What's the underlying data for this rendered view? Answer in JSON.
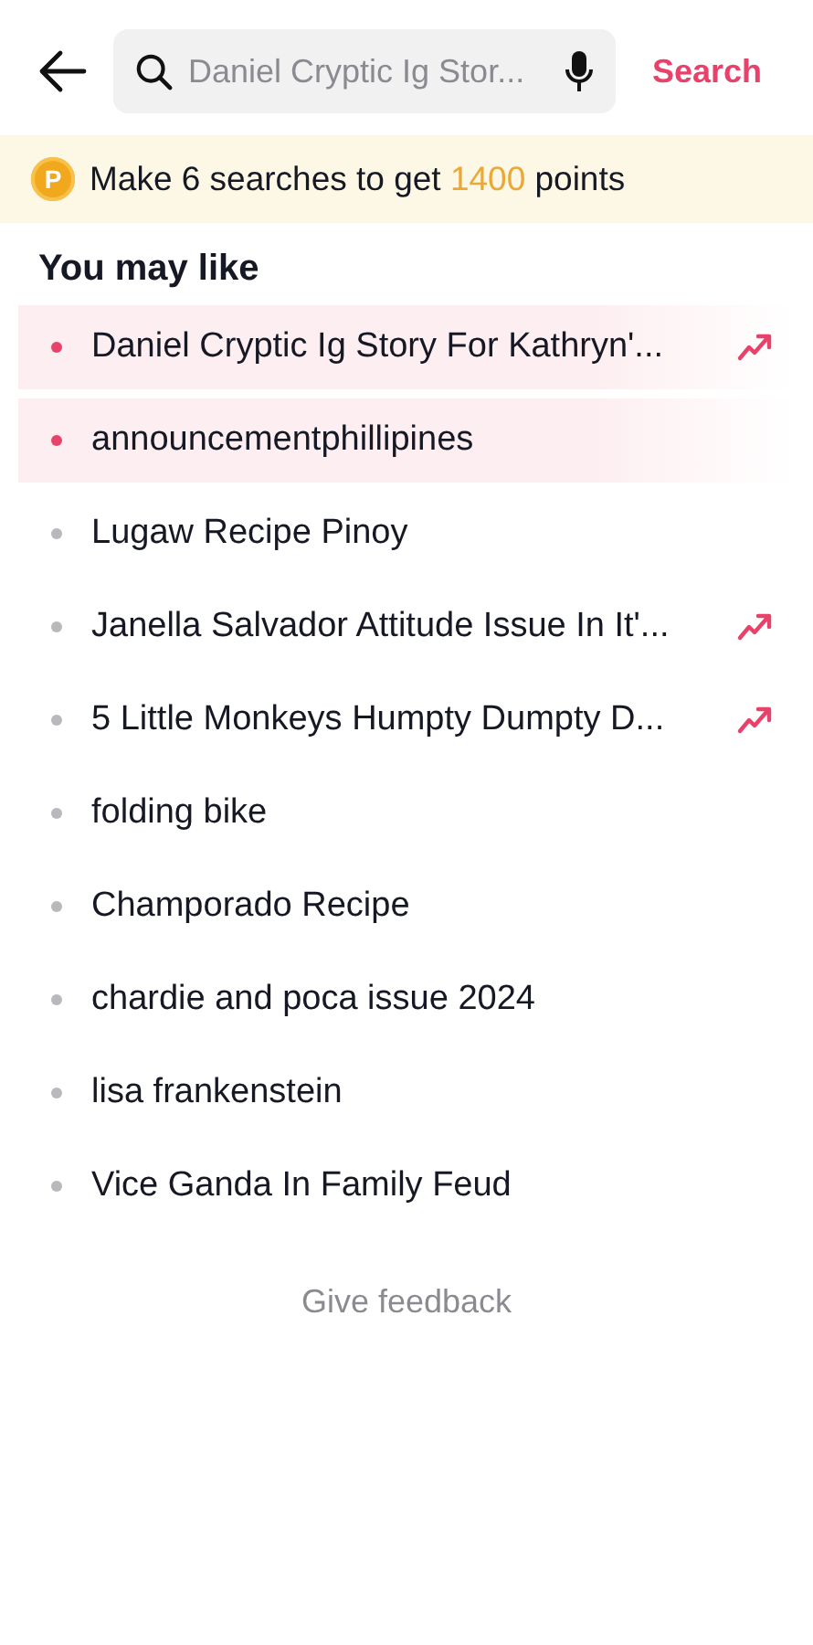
{
  "header": {
    "search": {
      "value": "Daniel Cryptic Ig Stor..."
    },
    "search_button": "Search"
  },
  "banner": {
    "text": "Make 6 searches to get **1400** points",
    "coin": "P"
  },
  "section_title": "You may like",
  "suggestions": [
    {
      "text": "Daniel Cryptic Ig Story For Kathryn'...",
      "highlighted": true,
      "trending": true
    },
    {
      "text": "announcementphillipines",
      "highlighted": true,
      "trending": false
    },
    {
      "text": "Lugaw Recipe Pinoy",
      "highlighted": false,
      "trending": false
    },
    {
      "text": "Janella Salvador Attitude Issue In It'...",
      "highlighted": false,
      "trending": true
    },
    {
      "text": "5 Little Monkeys Humpty Dumpty D...",
      "highlighted": false,
      "trending": true
    },
    {
      "text": "folding bike",
      "highlighted": false,
      "trending": false
    },
    {
      "text": "Champorado Recipe",
      "highlighted": false,
      "trending": false
    },
    {
      "text": "chardie and poca issue 2024",
      "highlighted": false,
      "trending": false
    },
    {
      "text": "lisa frankenstein",
      "highlighted": false,
      "trending": false
    },
    {
      "text": "Vice Ganda In Family Feud",
      "highlighted": false,
      "trending": false
    }
  ],
  "feedback": "Give feedback"
}
